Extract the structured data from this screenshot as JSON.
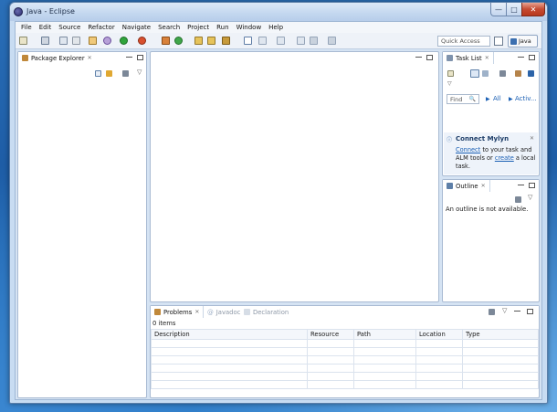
{
  "window": {
    "title": "Java - Eclipse"
  },
  "window_controls": {
    "minimize": "—",
    "maximize": "□",
    "close": "✕"
  },
  "menu": [
    "File",
    "Edit",
    "Source",
    "Refactor",
    "Navigate",
    "Search",
    "Project",
    "Run",
    "Window",
    "Help"
  ],
  "toolbar": {
    "quick_access": "Quick Access",
    "perspective": "Java"
  },
  "package_explorer": {
    "title": "Package Explorer",
    "close": "✕"
  },
  "task_list": {
    "title": "Task List",
    "find_placeholder": "Find",
    "filter_all": "All",
    "filter_active": "Activ..."
  },
  "connect_mylyn": {
    "title": "Connect Mylyn",
    "connect_link": "Connect",
    "text1": " to your task and",
    "text2": "ALM tools or ",
    "create_link": "create",
    "text3": " a local",
    "text4": "task."
  },
  "outline": {
    "title": "Outline",
    "message": "An outline is not available."
  },
  "bottom": {
    "tabs": [
      "Problems",
      "Javadoc",
      "Declaration"
    ],
    "item_count": "0 items",
    "columns": [
      "Description",
      "Resource",
      "Path",
      "Location",
      "Type"
    ]
  },
  "colors": {
    "accent": "#1a5fb4",
    "panel_border": "#a9bbd3",
    "title_bar": "#c3d7ef"
  }
}
